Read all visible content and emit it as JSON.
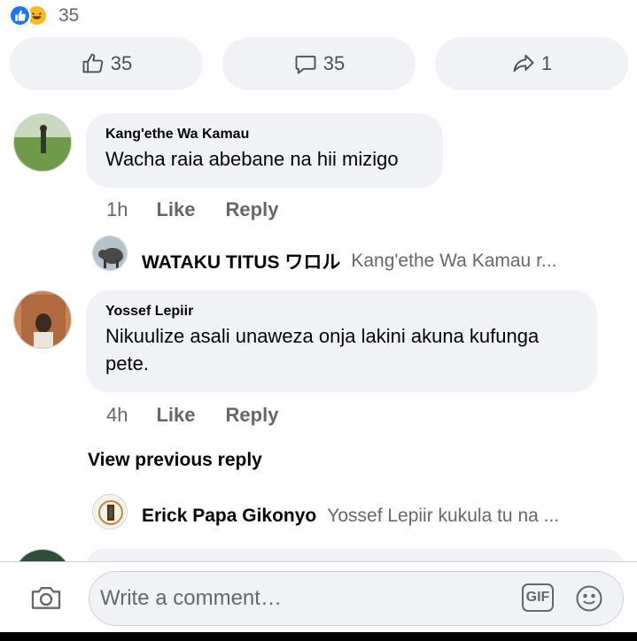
{
  "reactions": {
    "count": "35"
  },
  "actions": {
    "like_count": "35",
    "comment_count": "35",
    "share_count": "1"
  },
  "comments": [
    {
      "author": "Kang'ethe Wa Kamau",
      "text": "Wacha raia abebane na hii mizigo",
      "time": "1h",
      "like": "Like",
      "reply": "Reply",
      "reply_preview": {
        "author": "WATAKU TITUS ワロル",
        "text": "Kang'ethe Wa Kamau r..."
      }
    },
    {
      "author": "Yossef Lepiir",
      "text": "Nikuulize asali unaweza onja lakini akuna kufunga pete.",
      "time": "4h",
      "like": "Like",
      "reply": "Reply",
      "view_previous": "View previous reply",
      "reply_preview": {
        "author": "Erick Papa Gikonyo",
        "text": "Yossef Lepiir kukula tu na ..."
      }
    }
  ],
  "composer": {
    "placeholder": "Write a comment…",
    "gif_label": "GIF"
  },
  "colors": {
    "accent": "#1877f2",
    "bubble_bg": "#f0f2f5",
    "secondary_text": "#65676b"
  }
}
